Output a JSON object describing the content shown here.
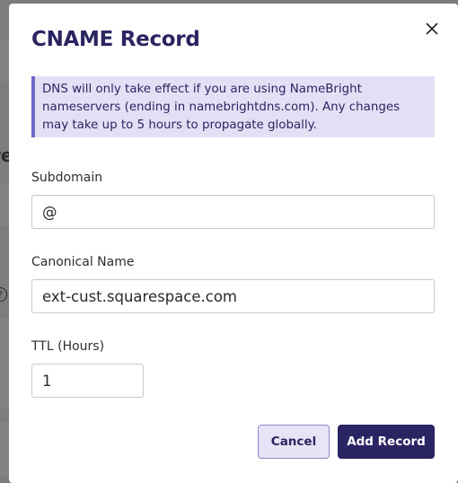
{
  "modal": {
    "title": "CNAME Record",
    "notice": "DNS will only take effect if you are using NameBright nameservers (ending in namebrightdns.com). Any changes may take up to 5 hours to propagate globally.",
    "fields": {
      "subdomain": {
        "label": "Subdomain",
        "value": "@"
      },
      "canonical_name": {
        "label": "Canonical Name",
        "value": "ext-cust.squarespace.com"
      },
      "ttl": {
        "label": "TTL (Hours)",
        "value": "1"
      }
    },
    "buttons": {
      "cancel": "Cancel",
      "add": "Add Record"
    }
  },
  "background": {
    "fragment_text": "re",
    "help_icon_glyph": "?"
  },
  "colors": {
    "title": "#2a2561",
    "notice_bg": "#e3e0f6",
    "notice_border": "#6f66c9",
    "primary_button": "#2b2463",
    "secondary_button_bg": "#e6e4f6",
    "overlay": "#7d7d7d"
  }
}
